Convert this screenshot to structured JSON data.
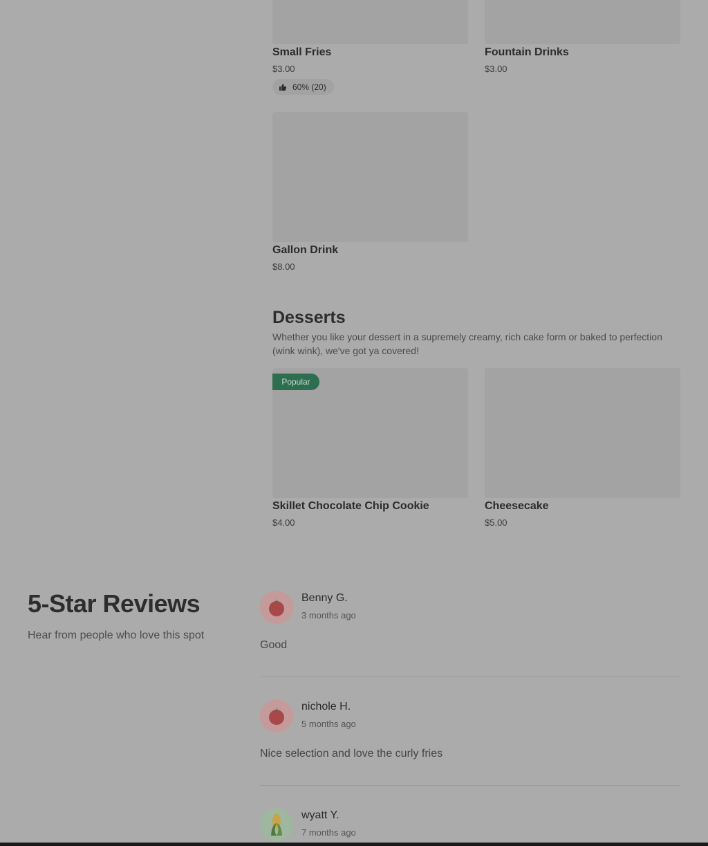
{
  "menu": {
    "items": [
      {
        "name": "Small Fries",
        "price": "$3.00"
      },
      {
        "name": "Fountain Drinks",
        "price": "$3.00"
      },
      {
        "name": "Gallon Drink",
        "price": "$8.00"
      }
    ],
    "small_fries_rating": "60% (20)"
  },
  "desserts": {
    "title": "Desserts",
    "description": "Whether you like your dessert in a supremely creamy, rich cake form or baked to perfection (wink wink), we've got ya covered!",
    "badge": "Popular",
    "items": [
      {
        "name": "Skillet Chocolate Chip Cookie",
        "price": "$4.00"
      },
      {
        "name": "Cheesecake",
        "price": "$5.00"
      }
    ]
  },
  "reviews": {
    "title": "5-Star Reviews",
    "subtitle": "Hear from people who love this spot",
    "list": [
      {
        "name": "Benny G.",
        "date": "3 months ago",
        "text": "Good",
        "avatar_icon": "tomato-icon"
      },
      {
        "name": "nichole H.",
        "date": "5 months ago",
        "text": "Nice selection and love the curly fries",
        "avatar_icon": "tomato-icon"
      },
      {
        "name": "wyatt Y.",
        "date": "7 months ago",
        "text": "",
        "avatar_icon": "corn-icon"
      }
    ]
  },
  "colors": {
    "overlay_bg": "#ababab",
    "popular_badge": "#2e6e50",
    "tomato_avatar_bg": "#c49a9a",
    "corn_avatar_bg": "#9fb79f"
  }
}
